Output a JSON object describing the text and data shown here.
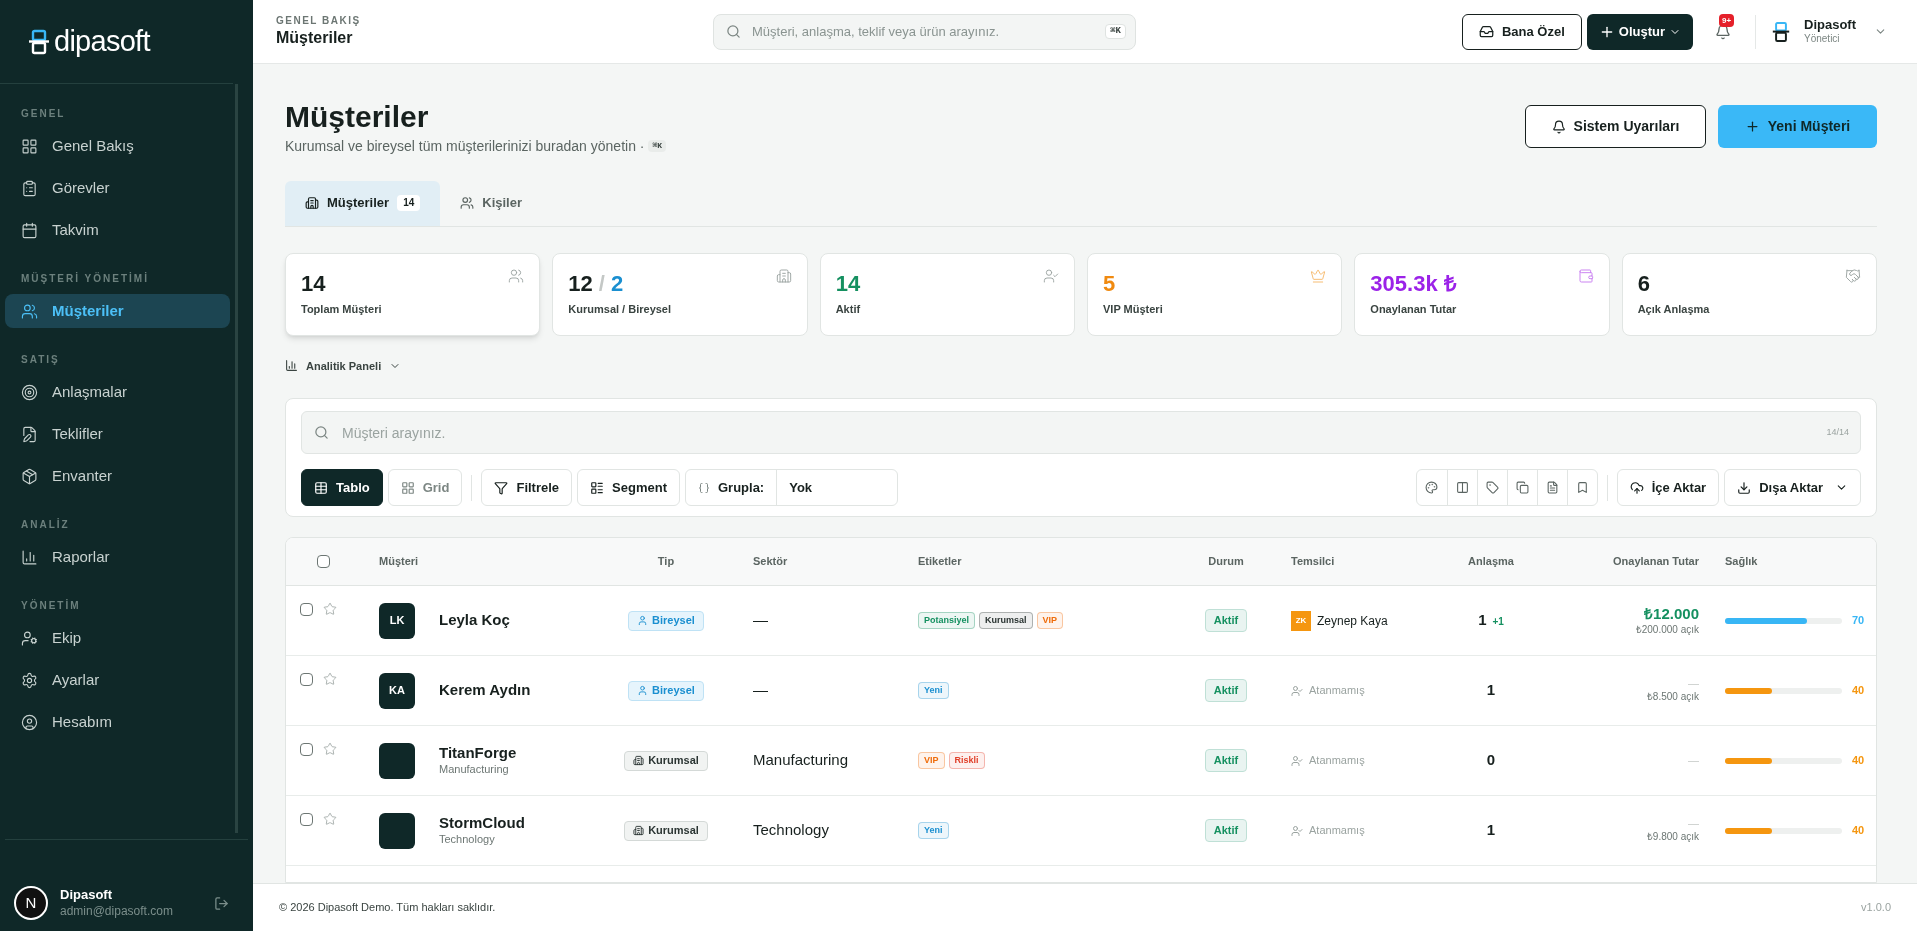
{
  "brand": {
    "name": "dipasoft"
  },
  "sidebar": {
    "sections": [
      {
        "title": "GENEL",
        "items": [
          {
            "label": "Genel Bakış",
            "selected": false
          },
          {
            "label": "Görevler",
            "selected": false
          },
          {
            "label": "Takvim",
            "selected": false
          }
        ]
      },
      {
        "title": "MÜŞTERİ YÖNETİMİ",
        "items": [
          {
            "label": "Müşteriler",
            "selected": true
          }
        ]
      },
      {
        "title": "SATIŞ",
        "items": [
          {
            "label": "Anlaşmalar",
            "selected": false
          },
          {
            "label": "Teklifler",
            "selected": false
          },
          {
            "label": "Envanter",
            "selected": false
          }
        ]
      },
      {
        "title": "ANALİZ",
        "items": [
          {
            "label": "Raporlar",
            "selected": false
          }
        ]
      },
      {
        "title": "YÖNETİM",
        "items": [
          {
            "label": "Ekip",
            "selected": false
          },
          {
            "label": "Ayarlar",
            "selected": false
          },
          {
            "label": "Hesabım",
            "selected": false
          }
        ]
      }
    ],
    "user": {
      "avatar": "N",
      "name": "Dipasoft",
      "email": "admin@dipasoft.com"
    }
  },
  "header": {
    "breadcrumb": "GENEL BAKIŞ",
    "title": "Müşteriler",
    "search": {
      "placeholder": "Müşteri, anlaşma, teklif veya ürün arayınız.",
      "shortcut": "⌘K"
    },
    "buttons": [
      "Bana Özel",
      "Oluştur"
    ],
    "notifications": "9+",
    "user": {
      "name": "Dipasoft",
      "role": "Yönetici"
    }
  },
  "page": {
    "title": "Müşteriler",
    "subtitle": "Kurumsal ve bireysel tüm müşterilerinizi buradan yönetin ·",
    "shortcut": "⌘K",
    "buttons": [
      "Sistem Uyarıları",
      "Yeni Müşteri"
    ]
  },
  "tabs": [
    {
      "label": "Müşteriler",
      "count": "14",
      "selected": true
    },
    {
      "label": "Kişiler",
      "selected": false
    }
  ],
  "stats": [
    {
      "parts": [
        {
          "text": "14",
          "color": "#17201e"
        }
      ],
      "label": "Toplam Müşteri",
      "selected": true
    },
    {
      "parts": [
        {
          "text": "12",
          "color": "#17201e"
        },
        {
          "text": "/",
          "color": "#c4c8c6"
        },
        {
          "text": "2",
          "color": "#1a8fd0"
        }
      ],
      "label": "Kurumsal / Bireysel",
      "selected": false
    },
    {
      "parts": [
        {
          "text": "14",
          "color": "#159060"
        }
      ],
      "label": "Aktif",
      "selected": false
    },
    {
      "parts": [
        {
          "text": "5",
          "color": "#f08a10"
        }
      ],
      "label": "VIP Müşteri",
      "selected": false
    },
    {
      "parts": [
        {
          "text": "305.3k ₺",
          "color": "#9b22e8"
        }
      ],
      "label": "Onaylanan Tutar",
      "selected": false
    },
    {
      "parts": [
        {
          "text": "6",
          "color": "#17201e"
        }
      ],
      "label": "Açık Anlaşma",
      "selected": false
    }
  ],
  "analytics": {
    "label": "Analitik Paneli",
    "expanded": false
  },
  "toolbar": {
    "search": {
      "placeholder": "Müşteri arayınız.",
      "count": "14/14"
    },
    "views": [
      {
        "label": "Tablo",
        "selected": true
      },
      {
        "label": "Grid",
        "selected": false
      }
    ],
    "filter": "Filtrele",
    "segment": "Segment",
    "group_label": "Grupla:",
    "group_value": "Yok",
    "import": "İçe Aktar",
    "export": "Dışa Aktar"
  },
  "table": {
    "select_all_checked": false,
    "columns": [
      "Müşteri",
      "Tip",
      "Sektör",
      "Etiketler",
      "Durum",
      "Temsilci",
      "Anlaşma",
      "Onaylanan Tutar",
      "Sağlık"
    ],
    "rows": [
      {
        "checked": false,
        "starred": false,
        "initials": "LK",
        "name": "Leyla Koç",
        "type": {
          "kind": "person",
          "label": "Bireysel"
        },
        "sector": "—",
        "tags": [
          {
            "label": "Potansiyel",
            "color": "#159060"
          },
          {
            "label": "Kurumsal",
            "color": "#2b3533"
          },
          {
            "label": "VIP",
            "color": "#ef6c0a"
          }
        ],
        "status": "Aktif",
        "rep": {
          "kind": "person",
          "initials": "ZK",
          "name": "Zeynep Kaya"
        },
        "deals": "1",
        "deals_extra": "+1",
        "amount": "₺12.000",
        "amount_open": "₺200.000 açık",
        "health": {
          "level": 0.7,
          "reading": "70",
          "color": "#38b6f5"
        }
      },
      {
        "checked": false,
        "starred": false,
        "initials": "KA",
        "name": "Kerem Aydın",
        "type": {
          "kind": "person",
          "label": "Bireysel"
        },
        "sector": "—",
        "tags": [
          {
            "label": "Yeni",
            "color": "#1a8fd0"
          }
        ],
        "status": "Aktif",
        "rep": {
          "kind": "none",
          "name": "Atanmamış"
        },
        "deals": "1",
        "amount": "—",
        "amount_open": "₺8.500 açık",
        "health": {
          "level": 0.4,
          "reading": "40",
          "color": "#f5960f"
        }
      },
      {
        "checked": false,
        "starred": false,
        "name": "TitanForge",
        "subtitle": "Manufacturing",
        "type": {
          "kind": "company",
          "label": "Kurumsal"
        },
        "sector": "Manufacturing",
        "tags": [
          {
            "label": "VIP",
            "color": "#ef6c0a"
          },
          {
            "label": "Riskli",
            "color": "#e0402a"
          }
        ],
        "status": "Aktif",
        "rep": {
          "kind": "none",
          "name": "Atanmamış"
        },
        "deals": "0",
        "amount": "—",
        "health": {
          "level": 0.4,
          "reading": "40",
          "color": "#f5960f"
        }
      },
      {
        "checked": false,
        "starred": false,
        "name": "StormCloud",
        "subtitle": "Technology",
        "type": {
          "kind": "company",
          "label": "Kurumsal"
        },
        "sector": "Technology",
        "tags": [
          {
            "label": "Yeni",
            "color": "#1a8fd0"
          }
        ],
        "status": "Aktif",
        "rep": {
          "kind": "none",
          "name": "Atanmamış"
        },
        "deals": "1",
        "amount": "—",
        "amount_open": "₺9.800 açık",
        "health": {
          "level": 0.4,
          "reading": "40",
          "color": "#f5960f"
        }
      }
    ]
  },
  "footer": {
    "copyright": "© 2026 Dipasoft Demo. Tüm hakları saklıdır.",
    "version": "v1.0.0"
  }
}
